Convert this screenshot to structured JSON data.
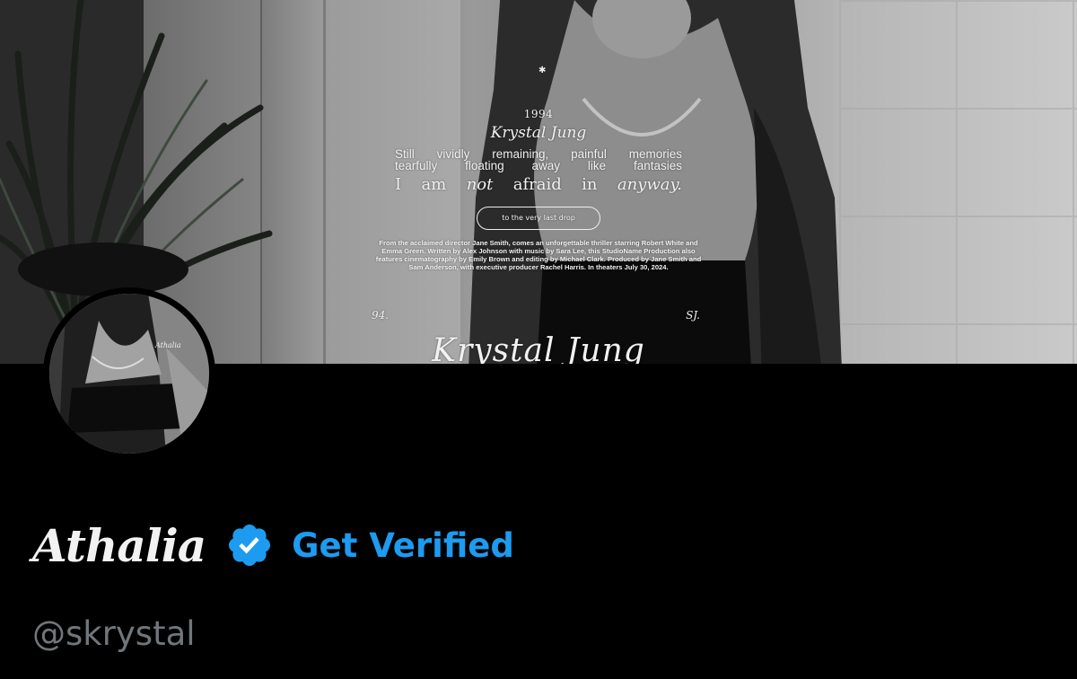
{
  "banner": {
    "year": "1994",
    "name": "Krystal Jung",
    "line1": "Still vividly remaining, painful memories",
    "line2": "tearfully floating away like fantasies",
    "afraid_words": [
      "I",
      "am",
      "not",
      "afraid",
      "in",
      "anyway."
    ],
    "pill": "to the very last drop",
    "credits": "From the acclaimed director Jane Smith, comes an unforgettable thriller starring Robert White and Emma Green. Written by Alex Johnson with music by Sara Lee, this StudioName Production also features cinematography by Emily Brown and editing by Michael Clark. Produced by Jane Smith and Sam Anderson, with executive producer Rachel Harris. In theaters July 30, 2024.",
    "corner_left": "94.",
    "corner_right": "SJ.",
    "big_name": "Krystal Jung",
    "avatar_watermark": "Athalia"
  },
  "profile": {
    "display_name": "Athalia",
    "verified_badge_icon": "verified-badge-icon",
    "get_verified_label": "Get Verified",
    "handle": "@skrystal",
    "colors": {
      "accent": "#1d9bf0",
      "handle": "#71767b",
      "background": "#000000"
    }
  }
}
